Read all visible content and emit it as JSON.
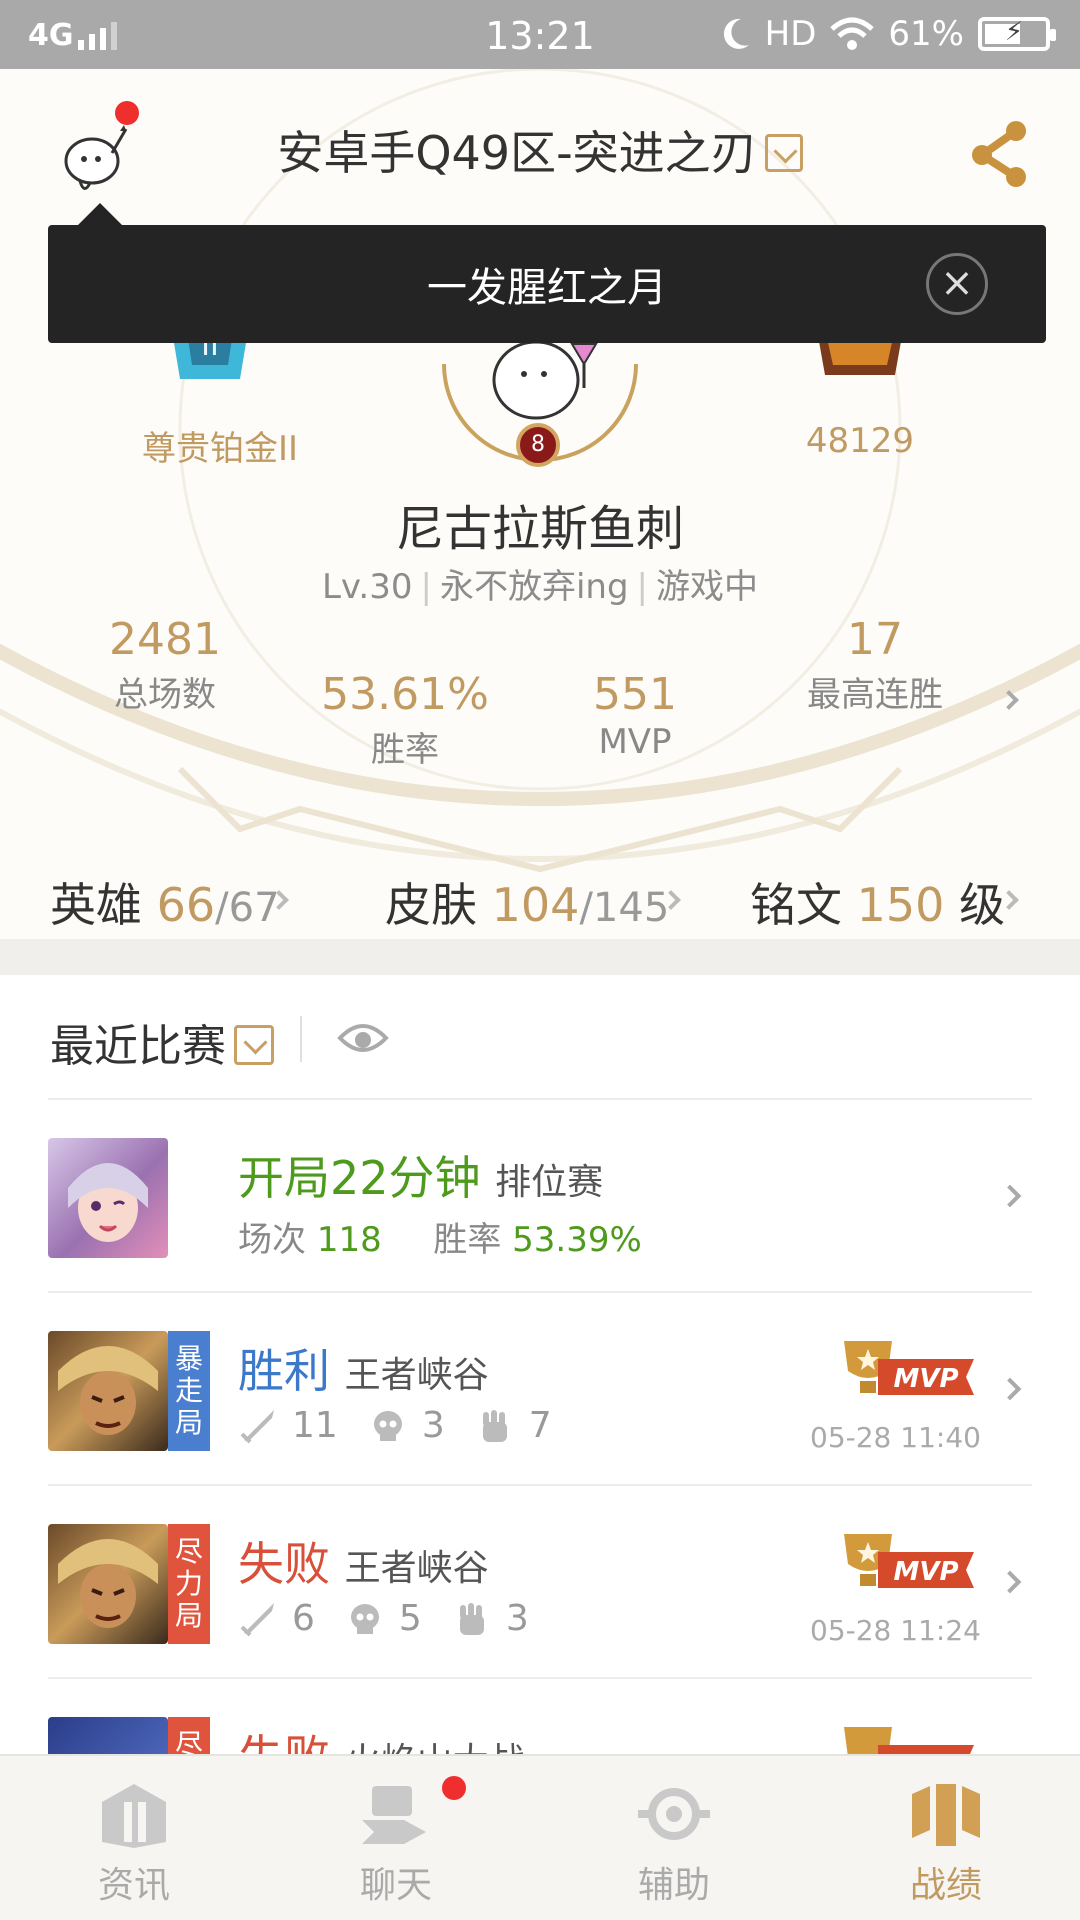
{
  "status_bar": {
    "network": "4G",
    "time": "13:21",
    "hd": "HD",
    "battery": "61%",
    "battery_level": 0.61
  },
  "header": {
    "server_title": "安卓手Q49区-突进之刃",
    "tooltip_text": "一发腥红之月"
  },
  "profile": {
    "rank": "尊贵铂金II",
    "power": "48129",
    "level_badge": "8",
    "name": "尼古拉斯鱼刺",
    "level": "Lv.30",
    "signature": "永不放弃ing",
    "state": "游戏中"
  },
  "stats": {
    "total_games": "2481",
    "total_games_label": "总场数",
    "win_rate": "53.61%",
    "win_rate_label": "胜率",
    "mvp": "551",
    "mvp_label": "MVP",
    "max_streak": "17",
    "max_streak_label": "最高连胜"
  },
  "collection": {
    "heroes_label": "英雄",
    "heroes_owned": "66",
    "heroes_total": "/67",
    "skins_label": "皮肤",
    "skins_owned": "104",
    "skins_total": "/145",
    "runes_label": "铭文",
    "runes_level": "150",
    "runes_unit": "级"
  },
  "recent": {
    "title": "最近比赛",
    "summary": {
      "headline": "开局22分钟",
      "mode": "排位赛",
      "games_label": "场次",
      "games": "118",
      "winrate_label": "胜率",
      "winrate": "53.39%"
    },
    "matches": [
      {
        "tag": "暴走局",
        "tag_color": "#4a7fd0",
        "result": "胜利",
        "result_color": "#3c79c9",
        "map": "王者峡谷",
        "kills": "11",
        "deaths": "3",
        "assists": "7",
        "date": "05-28 11:40",
        "badge": "MVP"
      },
      {
        "tag": "尽力局",
        "tag_color": "#e0543e",
        "result": "失败",
        "result_color": "#d9503a",
        "map": "王者峡谷",
        "kills": "6",
        "deaths": "5",
        "assists": "3",
        "date": "05-28 11:24",
        "badge": "MVP"
      },
      {
        "tag": "尽",
        "tag_color": "#e0543e",
        "result": "失败",
        "result_color": "#d9503a",
        "map": "火焰山大战"
      }
    ]
  },
  "nav": [
    {
      "label": "资讯",
      "icon": "news-icon"
    },
    {
      "label": "聊天",
      "icon": "chat-icon"
    },
    {
      "label": "辅助",
      "icon": "assist-icon"
    },
    {
      "label": "战绩",
      "icon": "record-icon"
    }
  ]
}
